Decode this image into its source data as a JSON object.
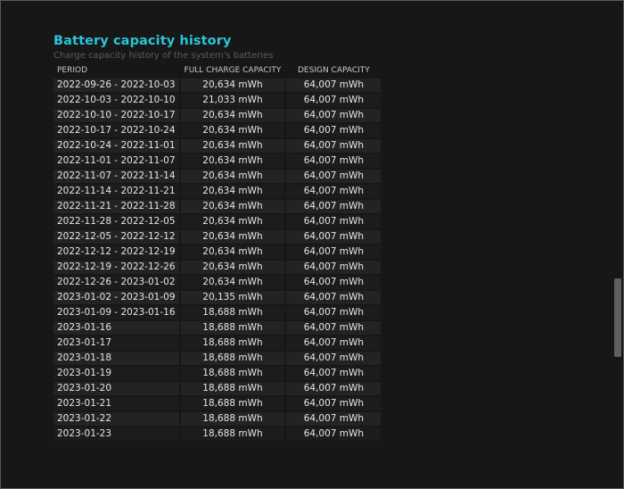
{
  "report": {
    "title": "Battery capacity history",
    "subtitle": "Charge capacity history of the system's batteries"
  },
  "table": {
    "headers": {
      "period": "PERIOD",
      "full_charge": "FULL CHARGE CAPACITY",
      "design": "DESIGN CAPACITY"
    },
    "rows": [
      {
        "period": "2022-09-26 - 2022-10-03",
        "full": "20,634 mWh",
        "design": "64,007 mWh"
      },
      {
        "period": "2022-10-03 - 2022-10-10",
        "full": "21,033 mWh",
        "design": "64,007 mWh"
      },
      {
        "period": "2022-10-10 - 2022-10-17",
        "full": "20,634 mWh",
        "design": "64,007 mWh"
      },
      {
        "period": "2022-10-17 - 2022-10-24",
        "full": "20,634 mWh",
        "design": "64,007 mWh"
      },
      {
        "period": "2022-10-24 - 2022-11-01",
        "full": "20,634 mWh",
        "design": "64,007 mWh"
      },
      {
        "period": "2022-11-01 - 2022-11-07",
        "full": "20,634 mWh",
        "design": "64,007 mWh"
      },
      {
        "period": "2022-11-07 - 2022-11-14",
        "full": "20,634 mWh",
        "design": "64,007 mWh"
      },
      {
        "period": "2022-11-14 - 2022-11-21",
        "full": "20,634 mWh",
        "design": "64,007 mWh"
      },
      {
        "period": "2022-11-21 - 2022-11-28",
        "full": "20,634 mWh",
        "design": "64,007 mWh"
      },
      {
        "period": "2022-11-28 - 2022-12-05",
        "full": "20,634 mWh",
        "design": "64,007 mWh"
      },
      {
        "period": "2022-12-05 - 2022-12-12",
        "full": "20,634 mWh",
        "design": "64,007 mWh"
      },
      {
        "period": "2022-12-12 - 2022-12-19",
        "full": "20,634 mWh",
        "design": "64,007 mWh"
      },
      {
        "period": "2022-12-19 - 2022-12-26",
        "full": "20,634 mWh",
        "design": "64,007 mWh"
      },
      {
        "period": "2022-12-26 - 2023-01-02",
        "full": "20,634 mWh",
        "design": "64,007 mWh"
      },
      {
        "period": "2023-01-02 - 2023-01-09",
        "full": "20,135 mWh",
        "design": "64,007 mWh"
      },
      {
        "period": "2023-01-09 - 2023-01-16",
        "full": "18,688 mWh",
        "design": "64,007 mWh"
      },
      {
        "period": "2023-01-16",
        "full": "18,688 mWh",
        "design": "64,007 mWh"
      },
      {
        "period": "2023-01-17",
        "full": "18,688 mWh",
        "design": "64,007 mWh"
      },
      {
        "period": "2023-01-18",
        "full": "18,688 mWh",
        "design": "64,007 mWh"
      },
      {
        "period": "2023-01-19",
        "full": "18,688 mWh",
        "design": "64,007 mWh"
      },
      {
        "period": "2023-01-20",
        "full": "18,688 mWh",
        "design": "64,007 mWh"
      },
      {
        "period": "2023-01-21",
        "full": "18,688 mWh",
        "design": "64,007 mWh"
      },
      {
        "period": "2023-01-22",
        "full": "18,688 mWh",
        "design": "64,007 mWh"
      },
      {
        "period": "2023-01-23",
        "full": "18,688 mWh",
        "design": "64,007 mWh"
      }
    ]
  },
  "colors": {
    "background": "#171717",
    "title": "#29c5d8",
    "subtitle": "#5d5d5d",
    "text": "#e6e6e6",
    "row_odd": "#232323",
    "row_even": "#1c1c1c",
    "scroll_thumb": "#5f5f5f"
  }
}
